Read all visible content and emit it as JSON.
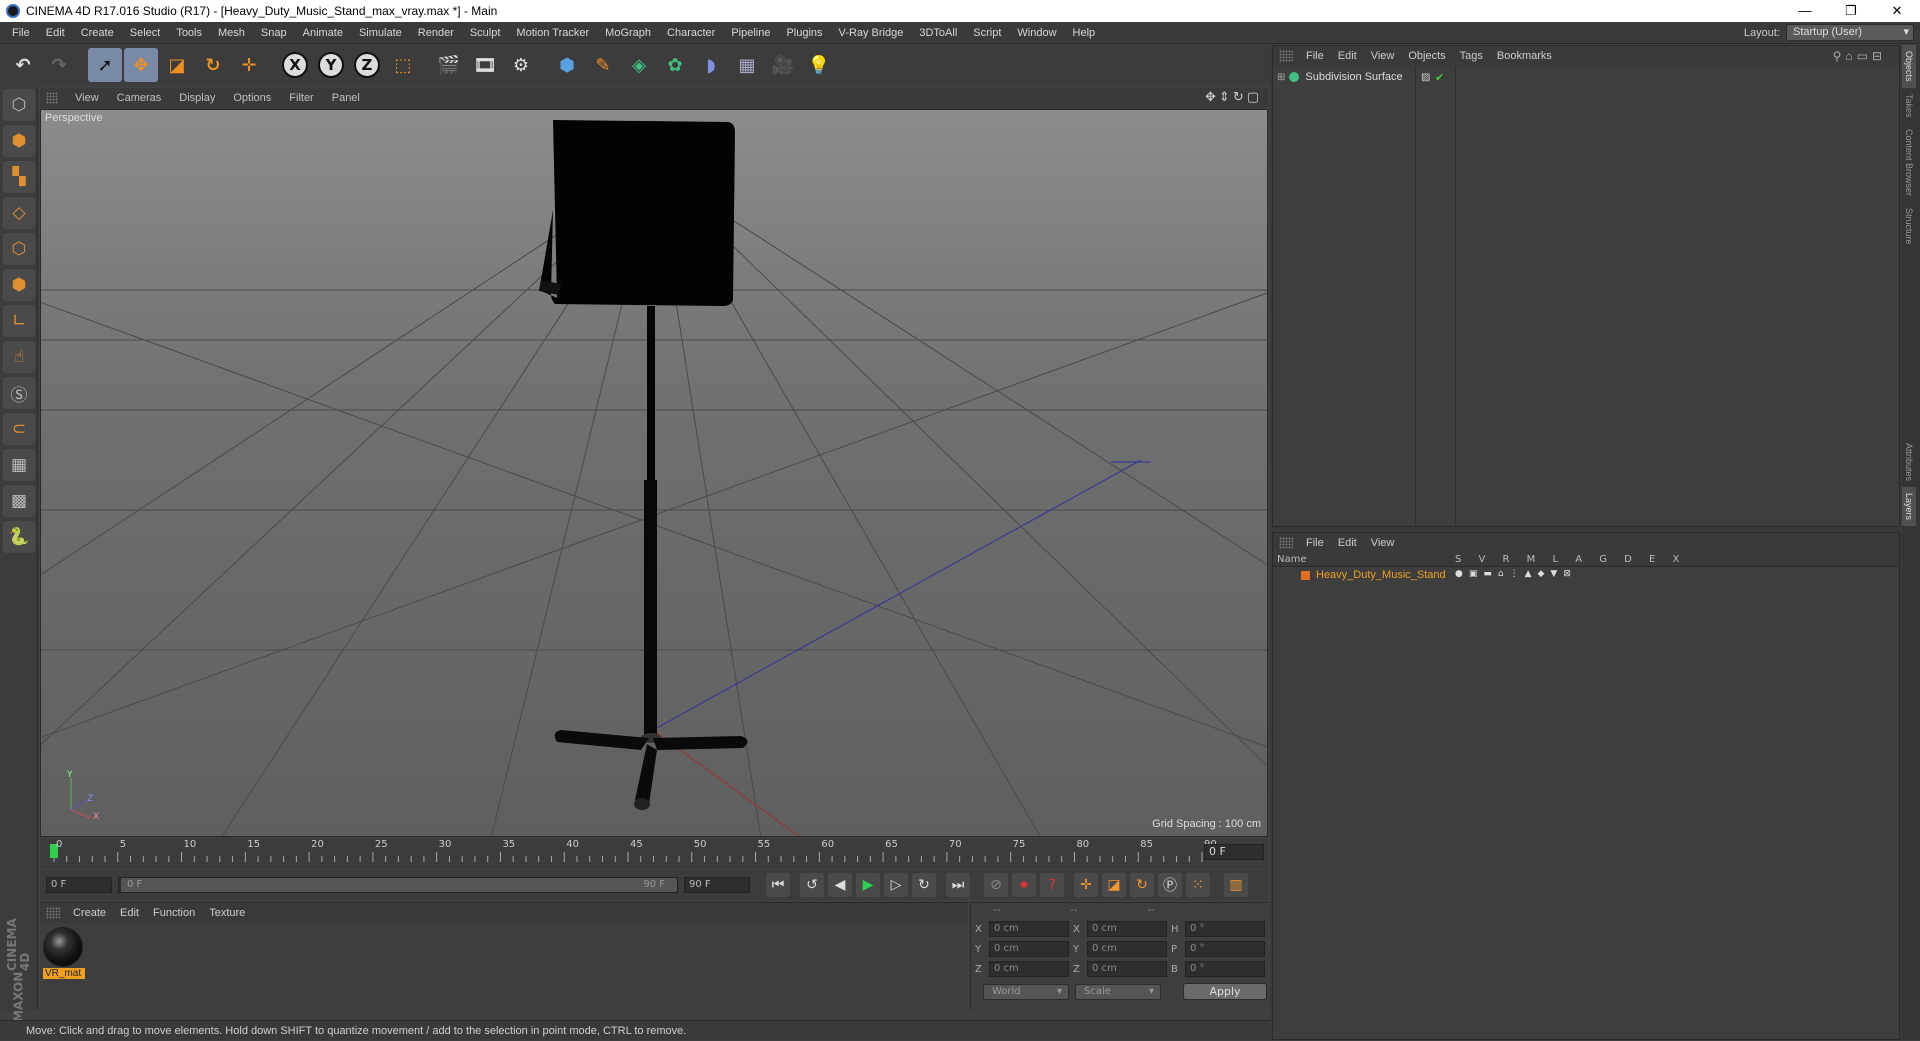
{
  "window": {
    "title": "CINEMA 4D R17.016 Studio (R17) - [Heavy_Duty_Music_Stand_max_vray.max *] - Main",
    "controls": [
      "—",
      "❐",
      "✕"
    ]
  },
  "menubar": {
    "items": [
      "File",
      "Edit",
      "Create",
      "Select",
      "Tools",
      "Mesh",
      "Snap",
      "Animate",
      "Simulate",
      "Render",
      "Sculpt",
      "Motion Tracker",
      "MoGraph",
      "Character",
      "Pipeline",
      "Plugins",
      "V-Ray Bridge",
      "3DToAll",
      "Script",
      "Window",
      "Help"
    ],
    "layout_label": "Layout:",
    "layout_value": "Startup (User)"
  },
  "toolbar": {
    "icons": [
      "undo-icon",
      "redo-icon",
      "live-selection-icon",
      "move-icon",
      "scale-icon",
      "rotate-icon",
      "move-2-icon",
      "x-axis-icon",
      "y-axis-icon",
      "z-axis-icon",
      "coordinate-system-icon",
      "render-view-icon",
      "render-picture-viewer-icon",
      "edit-render-settings-icon",
      "cube-icon",
      "pen-spline-icon",
      "subdivision-icon",
      "array-icon",
      "deformer-icon",
      "floor-icon",
      "camera-icon",
      "light-icon"
    ],
    "axis_labels": [
      "X",
      "Y",
      "Z"
    ]
  },
  "left_tools": [
    "model-mode-icon",
    "texture-mode-icon",
    "workplane-mode-icon",
    "points-mode-icon",
    "edges-mode-icon",
    "polygons-mode-icon",
    "axis-mode-icon",
    "tweak-mode-icon",
    "snap-icon",
    "magnet-icon",
    "workplane-lock-icon",
    "solo-icon",
    "python-icon"
  ],
  "brand": {
    "line1": "MAXON",
    "line2": "CINEMA 4D"
  },
  "viewport": {
    "menu": [
      "View",
      "Cameras",
      "Display",
      "Options",
      "Filter",
      "Panel"
    ],
    "label": "Perspective",
    "grid_spacing": "Grid Spacing : 100 cm",
    "axis_labels": [
      "Y",
      "X",
      "Z"
    ]
  },
  "timeline": {
    "tick_labels": [
      "0",
      "5",
      "10",
      "15",
      "20",
      "25",
      "30",
      "35",
      "40",
      "45",
      "50",
      "55",
      "60",
      "65",
      "70",
      "75",
      "80",
      "85",
      "90"
    ],
    "current_frame": "0 F"
  },
  "transport": {
    "start_field": "0 F",
    "range_start": "0 F",
    "range_end": "90 F",
    "end_field": "90 F"
  },
  "materials": {
    "menu": [
      "Create",
      "Edit",
      "Function",
      "Texture"
    ],
    "items": [
      {
        "name": "VR_mat"
      }
    ]
  },
  "coordinates": {
    "headers": [
      "--",
      "--",
      "--"
    ],
    "rows": [
      {
        "a": "X",
        "v1": "0 cm",
        "b": "X",
        "v2": "0 cm",
        "c": "H",
        "v3": "0 °"
      },
      {
        "a": "Y",
        "v1": "0 cm",
        "b": "Y",
        "v2": "0 cm",
        "c": "P",
        "v3": "0 °"
      },
      {
        "a": "Z",
        "v1": "0 cm",
        "b": "Z",
        "v2": "0 cm",
        "c": "B",
        "v3": "0 °"
      }
    ],
    "world": "World",
    "scale": "Scale",
    "apply": "Apply"
  },
  "status": "Move: Click and drag to move elements. Hold down SHIFT to quantize movement / add to the selection in point mode, CTRL to remove.",
  "object_manager": {
    "menu": [
      "File",
      "Edit",
      "View",
      "Objects",
      "Tags",
      "Bookmarks"
    ],
    "objects": [
      {
        "name": "Subdivision Surface"
      }
    ]
  },
  "layer_manager": {
    "menu": [
      "File",
      "Edit",
      "View"
    ],
    "column_name": "Name",
    "flags": "S V R M L A G D E X",
    "layers": [
      {
        "name": "Heavy_Duty_Music_Stand",
        "color": "#e07020"
      }
    ]
  },
  "side_tabs": [
    "Objects",
    "Takes",
    "Content Browser",
    "Structure",
    "Attributes",
    "Layers"
  ],
  "colors": {
    "accent": "#f0a020",
    "selection": "#7a8ba8",
    "play": "#2ed050",
    "record": "#e03030"
  }
}
